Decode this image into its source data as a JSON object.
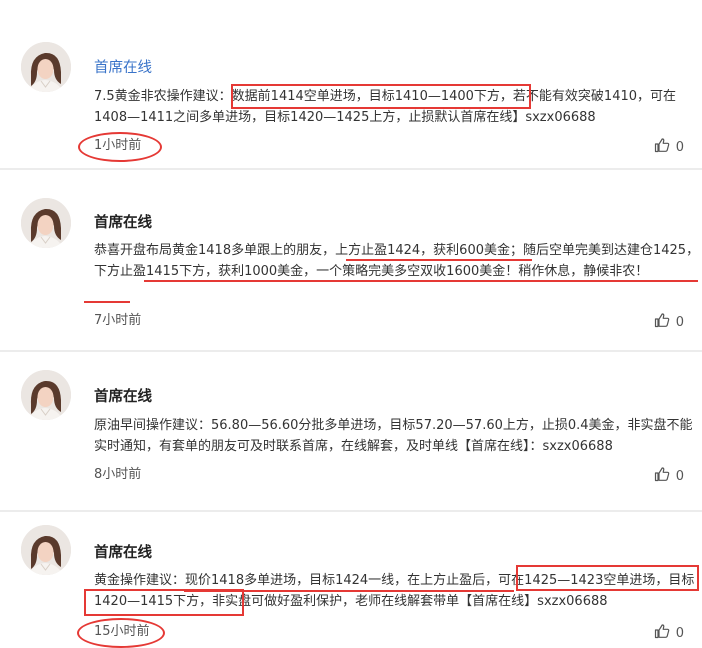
{
  "posts": [
    {
      "author": "首席在线",
      "content": "7.5黄金非农操作建议：数据前1414空单进场，目标1410—1400下方，若不能有效突破1410，可在1408—1411之间多单进场，目标1420—1425上方，止损默认首席在线】sxzx06688",
      "time": "1小时前",
      "likes": "0"
    },
    {
      "author": "首席在线",
      "content": "恭喜开盘布局黄金1418多单跟上的朋友，上方止盈1424，获利600美金；随后空单完美到达建仓1425，下方止盈1415下方，获利1000美金，一个策略完美多空双收1600美金！稍作休息，静候非农！",
      "time": "7小时前",
      "likes": "0"
    },
    {
      "author": "首席在线",
      "content": "原油早间操作建议：56.80—56.60分批多单进场，目标57.20—57.60上方，止损0.4美金，非实盘不能实时通知，有套单的朋友可及时联系首席，在线解套，及时单线【首席在线】：sxzx06688",
      "time": "8小时前",
      "likes": "0"
    },
    {
      "author": "首席在线",
      "content": "黄金操作建议：现价1418多单进场，目标1424一线，在上方止盈后，可在1425—1423空单进场，目标1420—1415下方，非实盘可做好盈利保护，老师在线解套带单【首席在线】sxzx06688",
      "time": "15小时前",
      "likes": "0"
    }
  ],
  "icons": {
    "like": "thumbs-up-icon",
    "avatar": "profile-photo"
  },
  "colors": {
    "accent_blue": "#3a74c9",
    "annotation_red": "#e53935",
    "divider": "#ececec"
  }
}
